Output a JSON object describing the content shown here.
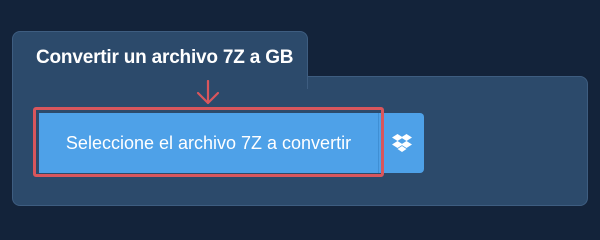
{
  "panel": {
    "tab_title": "Convertir un archivo 7Z a GB"
  },
  "upload": {
    "select_label": "Seleccione el archivo 7Z a convertir",
    "dropbox_icon": "dropbox-icon"
  },
  "colors": {
    "background": "#13233a",
    "panel": "#2c4a6b",
    "button": "#4ea1e8",
    "highlight": "#d9565c"
  }
}
